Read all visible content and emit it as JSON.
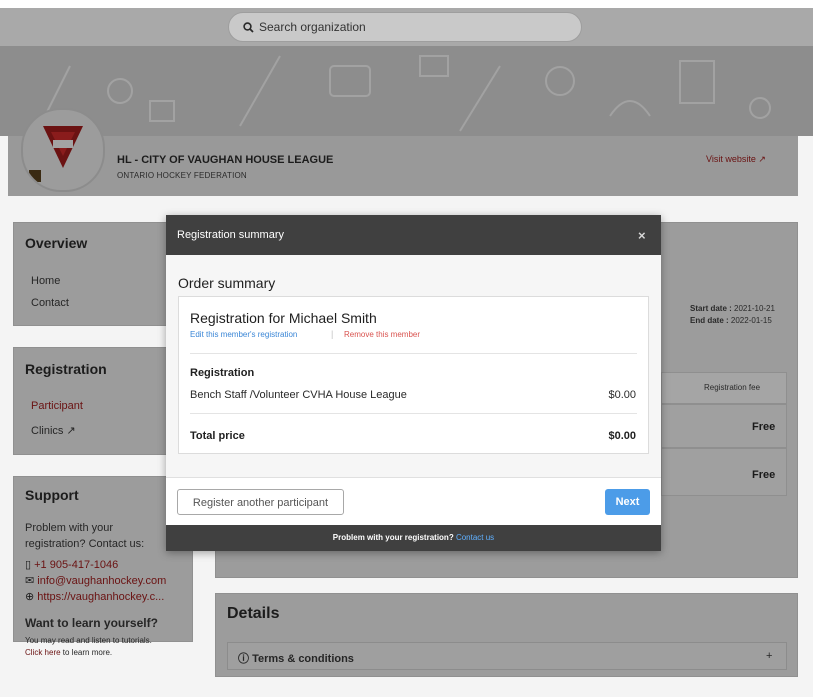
{
  "search": {
    "placeholder": "Search organization"
  },
  "org": {
    "name": "HL - CITY OF VAUGHAN HOUSE LEAGUE",
    "federation": "ONTARIO HOCKEY FEDERATION",
    "visit_website": "Visit website ↗"
  },
  "overview": {
    "title": "Overview",
    "items": [
      {
        "label": "Home"
      },
      {
        "label": "Contact"
      }
    ]
  },
  "registration": {
    "title": "Registration",
    "items": [
      {
        "label": "Participant"
      },
      {
        "label": "Clinics ↗"
      }
    ]
  },
  "support": {
    "title": "Support",
    "text1": "Problem with your",
    "text2": "registration? Contact us:",
    "phone": "+1 905-417-1046",
    "email": "info@vaughanhockey.com",
    "website": "https://vaughanhockey.c...",
    "learn_title": "Want to learn yourself?",
    "learn_text": "You may read and listen to tutorials.",
    "learn_link": "Click here",
    "learn_suffix": " to learn more."
  },
  "event": {
    "start_date_label": "Start date :",
    "start_date": "2021-10-21",
    "end_date_label": "End date :",
    "end_date": "2022-01-15",
    "fee_header": "Registration fee",
    "rows": [
      {
        "fee": "Free"
      },
      {
        "fee": "Free"
      }
    ]
  },
  "details": {
    "title": "Details",
    "terms": "Terms & conditions",
    "expand": "+"
  },
  "modal": {
    "title": "Registration summary",
    "close": "×",
    "order_title": "Order summary",
    "registration_for": "Registration for Michael Smith",
    "edit_link": "Edit this member's registration",
    "separator": "|",
    "remove_link": "Remove this member",
    "section_label": "Registration",
    "line_item": "Bench Staff /Volunteer CVHA House League",
    "line_price": "$0.00",
    "total_label": "Total price",
    "total_value": "$0.00",
    "register_another": "Register another participant",
    "next": "Next",
    "footer_text": "Problem with your registration?",
    "footer_link": "Contact us"
  },
  "colors": {
    "accent_blue": "#4c9ce8",
    "link_red": "#d9534f",
    "modal_header": "#404040"
  },
  "icons": [
    "search-icon",
    "external-link-icon",
    "phone-icon",
    "mail-icon",
    "globe-icon",
    "info-icon",
    "close-icon"
  ]
}
